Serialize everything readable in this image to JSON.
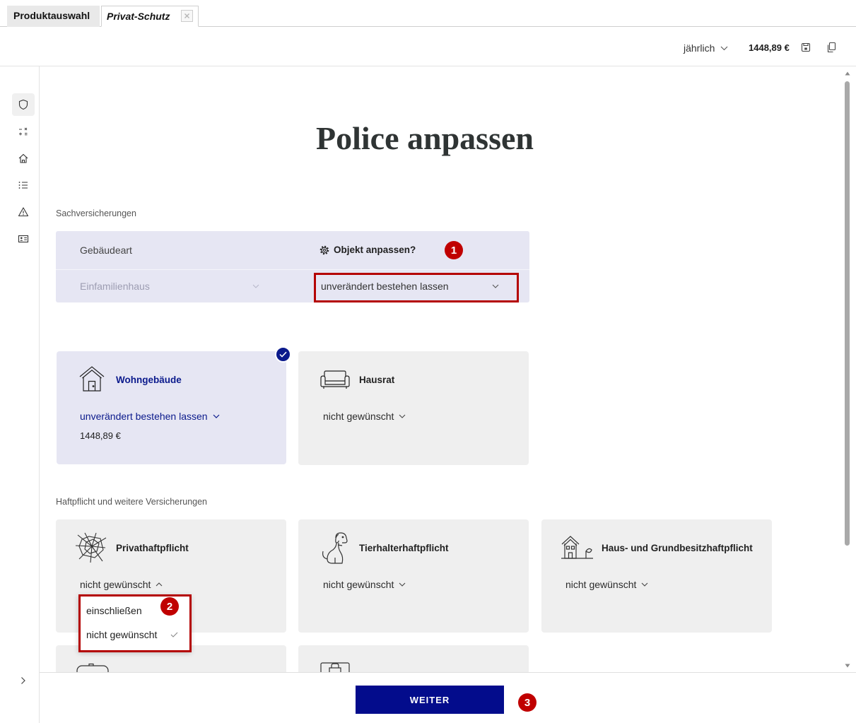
{
  "tabs": {
    "product_selection": "Produktauswahl",
    "active": "Privat-Schutz"
  },
  "header": {
    "payment_period": "jährlich",
    "total_price": "1448,89 €"
  },
  "sidebar": {
    "items": [
      {
        "icon": "shield-icon",
        "active": true
      },
      {
        "icon": "calculator-icon",
        "active": false
      },
      {
        "icon": "house-icon",
        "active": false
      },
      {
        "icon": "list-icon",
        "active": false
      },
      {
        "icon": "warning-icon",
        "active": false
      },
      {
        "icon": "id-card-icon",
        "active": false
      }
    ],
    "expand_icon": "chevron-right-icon"
  },
  "main": {
    "title": "Police anpassen",
    "property_section": {
      "label": "Sachversicherungen",
      "building_type_label": "Gebäudeart",
      "adjust_object_label": "Objekt anpassen?",
      "building_type_value": "Einfamilienhaus",
      "adjust_object_value": "unverändert bestehen lassen"
    },
    "property_cards": [
      {
        "title": "Wohngebäude",
        "option": "unverändert bestehen lassen",
        "price": "1448,89 €",
        "selected": true,
        "icon": "building-icon"
      },
      {
        "title": "Hausrat",
        "option": "nicht gewünscht",
        "selected": false,
        "icon": "sofa-icon"
      }
    ],
    "liability_section": {
      "label": "Haftpflicht und weitere Versicherungen",
      "cards": [
        {
          "title": "Privathaftpflicht",
          "option": "nicht gewünscht",
          "icon": "broken-glass-icon",
          "dropdown_open": true
        },
        {
          "title": "Tierhalterhaftpflicht",
          "option": "nicht gewünscht",
          "icon": "dog-icon",
          "dropdown_open": false
        },
        {
          "title": "Haus- und Grundbesitzhaftpflicht",
          "option": "nicht gewünscht",
          "icon": "house-tree-icon",
          "dropdown_open": false
        }
      ]
    },
    "dropdown": {
      "options": [
        {
          "label": "einschließen",
          "checked": false
        },
        {
          "label": "nicht gewünscht",
          "checked": true
        }
      ]
    }
  },
  "footer": {
    "next_label": "WEITER"
  },
  "annotations": [
    "1",
    "2",
    "3"
  ],
  "colors": {
    "brand_navy": "#0b1a8c",
    "selected_card": "#e6e6f3",
    "card": "#efefef",
    "annotation_red": "#b80000"
  }
}
